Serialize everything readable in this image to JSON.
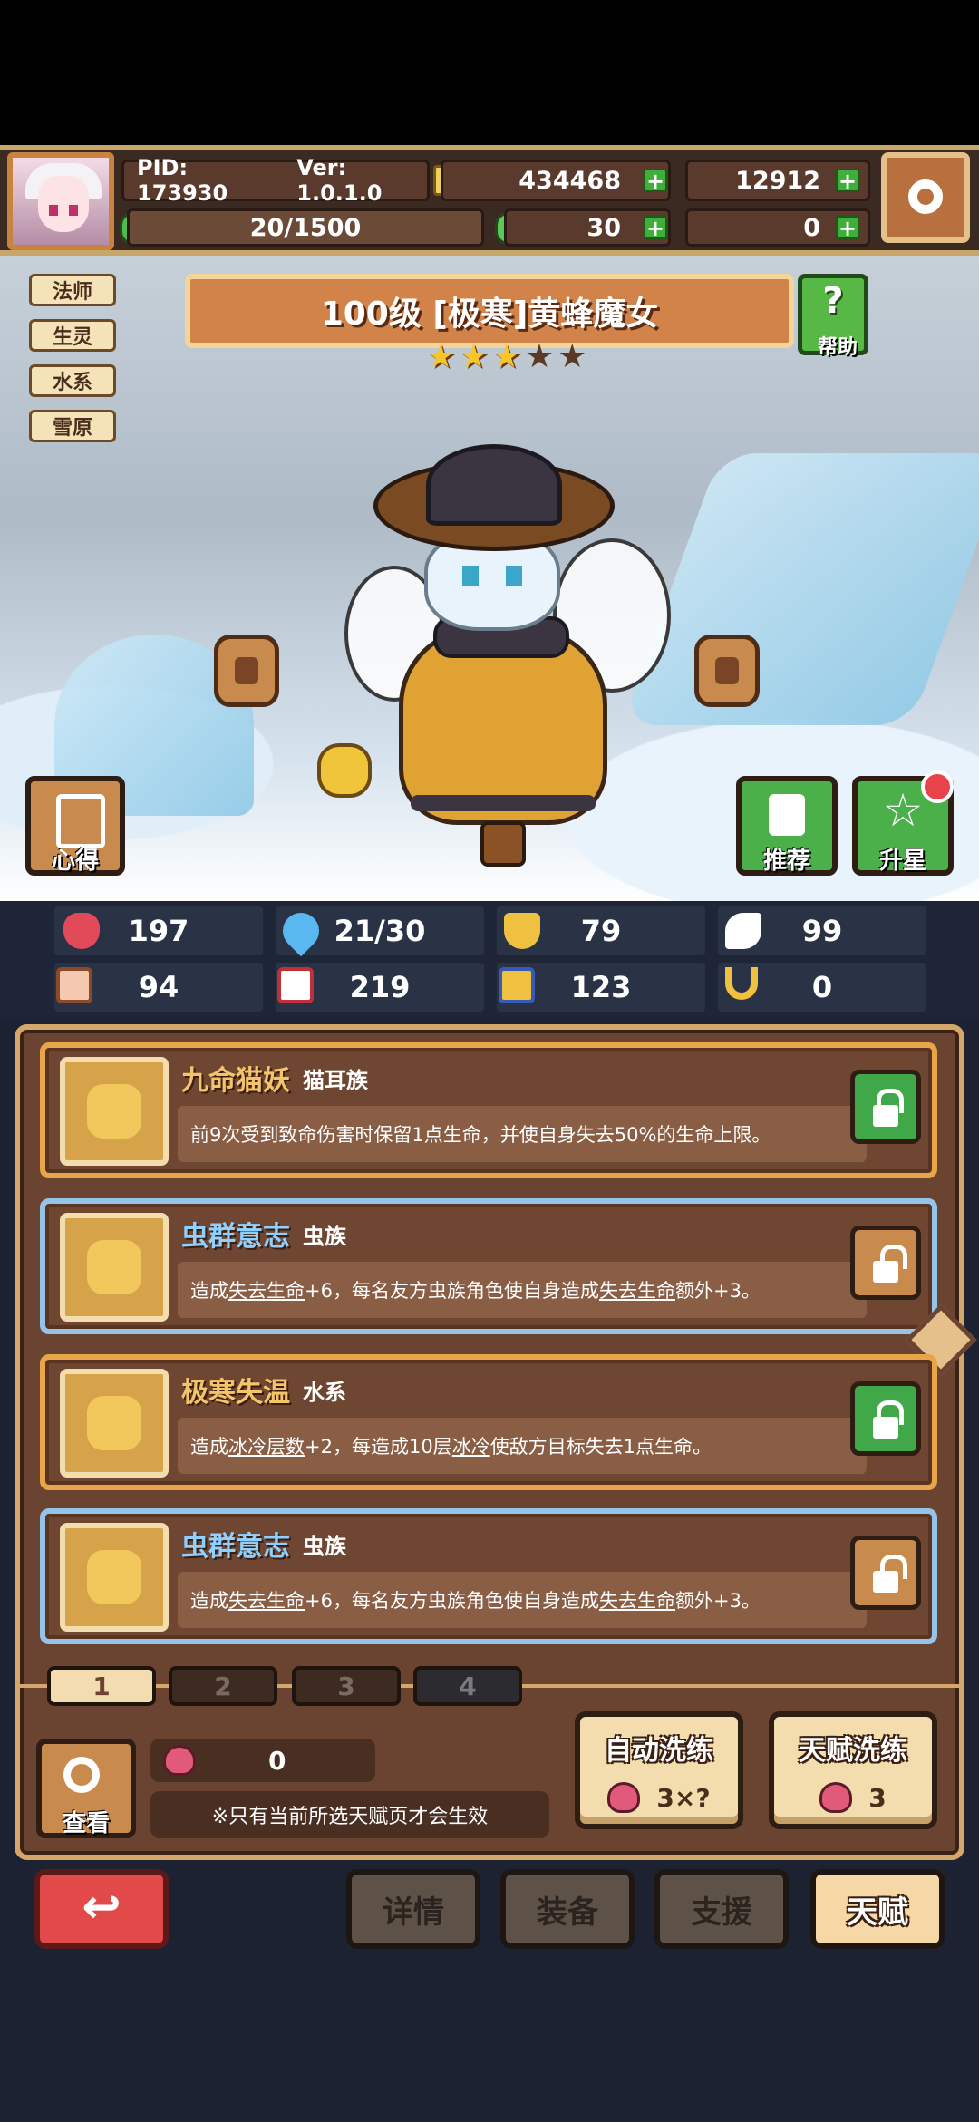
{
  "header": {
    "pid": "PID: 173930",
    "version": "Ver: 1.0.1.0",
    "coins": "434468",
    "gems": "12912",
    "xp": "20/1500",
    "clover": "30",
    "horn": "0"
  },
  "tags": [
    "法师",
    "生灵",
    "水系",
    "雪原"
  ],
  "character": {
    "title": "100级  [极寒]黄蜂魔女",
    "stars_filled": 3,
    "stars_total": 5
  },
  "buttons": {
    "help": "帮助",
    "xinde": "心得",
    "recommend": "推荐",
    "upstar": "升星"
  },
  "stats": [
    "197",
    "21/30",
    "79",
    "99",
    "94",
    "219",
    "123",
    "0"
  ],
  "talents": [
    {
      "name": "九命猫妖",
      "type": "猫耳族",
      "desc": "前9次受到致命伤害时保留1点生命，并使自身失去50%的生命上限。",
      "locked": true
    },
    {
      "name": "虫群意志",
      "type": "虫族",
      "desc_a": "造成",
      "u1": "失去生命",
      "desc_b": "+6，每名友方虫族角色使自身造成",
      "u2": "失去生命",
      "desc_c": "额外+3。",
      "locked": false
    },
    {
      "name": "极寒失温",
      "type": "水系",
      "desc_a": "造成",
      "u1": "冰冷层数",
      "desc_b": "+2，每造成10层",
      "u2": "冰冷",
      "desc_c": "使敌方目标失去1点生命。",
      "locked": true
    },
    {
      "name": "虫群意志",
      "type": "虫族",
      "desc_a": "造成",
      "u1": "失去生命",
      "desc_b": "+6，每名友方虫族角色使自身造成",
      "u2": "失去生命",
      "desc_c": "额外+3。",
      "locked": false
    }
  ],
  "pages": [
    "1",
    "2",
    "3",
    "4"
  ],
  "footer": {
    "view": "查看",
    "apples": "0",
    "note": "※只有当前所选天赋页才会生效",
    "auto_wash": "自动洗练",
    "auto_cost": "3×?",
    "talent_wash": "天赋洗练",
    "talent_cost": "3"
  },
  "nav": [
    "详情",
    "装备",
    "支援",
    "天赋"
  ],
  "colors": {
    "accent": "#d6a76a",
    "green": "#41a84a",
    "red": "#e24a4a"
  }
}
